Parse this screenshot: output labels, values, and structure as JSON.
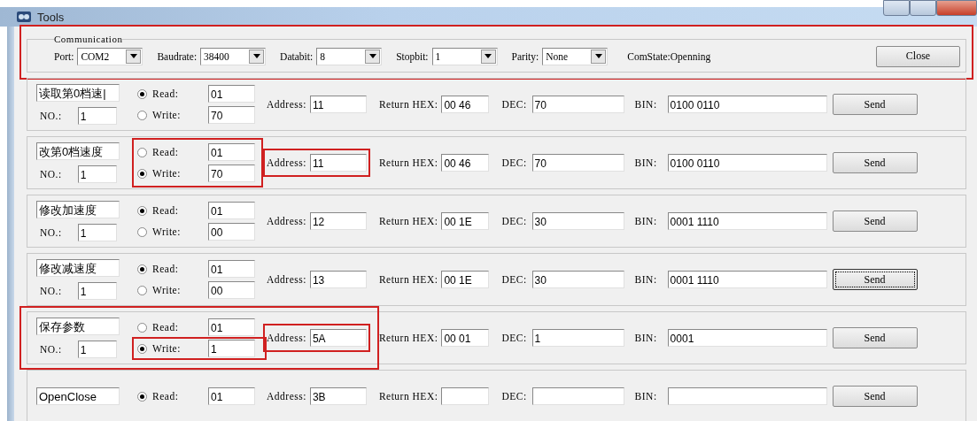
{
  "window": {
    "title": "Tools"
  },
  "communication": {
    "title": "Communication",
    "highlighted": true,
    "combos": [
      {
        "label": "Port:",
        "value": "COM2"
      },
      {
        "label": "Baudrate:",
        "value": "38400"
      },
      {
        "label": "Databit:",
        "value": "8"
      },
      {
        "label": "Stopbit:",
        "value": "1"
      },
      {
        "label": "Parity:",
        "value": "None"
      }
    ],
    "status": "ComState:Openning",
    "button": "Close"
  },
  "rows": [
    {
      "name": "读取第0档速|",
      "no_label": "NO.:",
      "no": "1",
      "radios": [
        {
          "label": "Read:",
          "selected": true,
          "value": "01"
        },
        {
          "label": "Write:",
          "selected": false,
          "value": "70"
        }
      ],
      "address_label": "Address:",
      "address": "11",
      "hex_label": "Return HEX:",
      "hex": "00 46",
      "dec_label": "DEC:",
      "dec": "70",
      "bin_label": "BIN:",
      "bin": "0100 0110",
      "send": "Send",
      "focused": false
    },
    {
      "name": "改第0档速度",
      "no_label": "NO.:",
      "no": "1",
      "radios": [
        {
          "label": "Read:",
          "selected": false,
          "value": "01",
          "highlighted": true
        },
        {
          "label": "Write:",
          "selected": true,
          "value": "70",
          "highlighted": true
        }
      ],
      "address_label": "Address:",
      "address": "11",
      "address_highlighted": true,
      "hex_label": "Return HEX:",
      "hex": "00 46",
      "dec_label": "DEC:",
      "dec": "70",
      "bin_label": "BIN:",
      "bin": "0100 0110",
      "send": "Send",
      "focused": false
    },
    {
      "name": "修改加速度",
      "no_label": "NO.:",
      "no": "1",
      "radios": [
        {
          "label": "Read:",
          "selected": true,
          "value": "01"
        },
        {
          "label": "Write:",
          "selected": false,
          "value": "00"
        }
      ],
      "address_label": "Address:",
      "address": "12",
      "hex_label": "Return HEX:",
      "hex": "00 1E",
      "dec_label": "DEC:",
      "dec": "30",
      "bin_label": "BIN:",
      "bin": "0001 1110",
      "send": "Send",
      "focused": false
    },
    {
      "name": "修改减速度",
      "no_label": "NO.:",
      "no": "1",
      "radios": [
        {
          "label": "Read:",
          "selected": true,
          "value": "01"
        },
        {
          "label": "Write:",
          "selected": false,
          "value": "00"
        }
      ],
      "address_label": "Address:",
      "address": "13",
      "hex_label": "Return HEX:",
      "hex": "00 1E",
      "dec_label": "DEC:",
      "dec": "30",
      "bin_label": "BIN:",
      "bin": "0001 1110",
      "send": "Send",
      "focused": true
    },
    {
      "name": "保存参数",
      "no_label": "NO.:",
      "no": "1",
      "radios": [
        {
          "label": "Read:",
          "selected": false,
          "value": "01"
        },
        {
          "label": "Write:",
          "selected": true,
          "value": "1",
          "highlighted": true
        }
      ],
      "address_label": "Address:",
      "address": "5A",
      "address_highlighted": true,
      "hex_label": "Return HEX:",
      "hex": "00 01",
      "dec_label": "DEC:",
      "dec": "1",
      "bin_label": "BIN:",
      "bin": "0001",
      "send": "Send",
      "focused": false,
      "highlighted": true
    },
    {
      "name": "OpenClose",
      "radios": [
        {
          "label": "Read:",
          "selected": true,
          "value": "01"
        }
      ],
      "address_label": "Address:",
      "address": "3B",
      "hex_label": "Return HEX:",
      "dec_label": "DEC:",
      "bin_label": "BIN:",
      "send": "Send",
      "focused": false
    }
  ]
}
